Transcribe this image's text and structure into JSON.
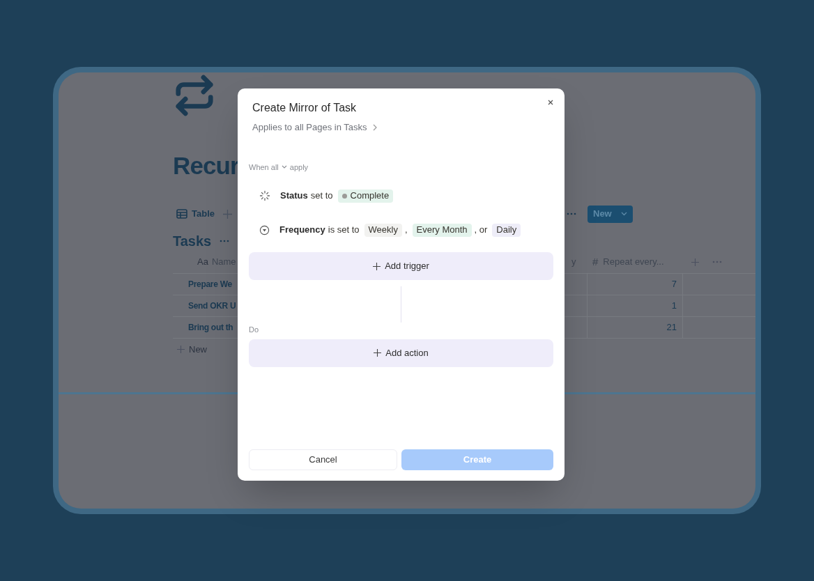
{
  "backdrop": {
    "title": "Recur",
    "view_tab": "Table",
    "database_title": "Tasks",
    "name_column_icon": "Aa",
    "name_column": "Name",
    "partial_column": "y",
    "repeat_column_icon": "#",
    "repeat_column": "Repeat every...",
    "new_button": "New",
    "rows": [
      {
        "name": "Prepare We",
        "repeat": "7"
      },
      {
        "name": "Send OKR U",
        "repeat": "1"
      },
      {
        "name": "Bring out th",
        "repeat": "21"
      }
    ],
    "new_row": "New"
  },
  "dialog": {
    "title": "Create Mirror of Task",
    "subtitle": "Applies to all Pages in Tasks",
    "when_prefix": "When all",
    "when_suffix": "apply",
    "triggers": [
      {
        "kind": "status",
        "property": "Status",
        "verb": "set to",
        "parts": [
          {
            "kind": "tag",
            "label": "Complete",
            "color": "#e3f3ec",
            "dot": true
          }
        ]
      },
      {
        "kind": "select",
        "property": "Frequency",
        "verb": "is set to",
        "parts": [
          {
            "kind": "tag",
            "label": "Weekly",
            "color": "#f2f2f0",
            "dot": false
          },
          {
            "kind": "text",
            "text": ","
          },
          {
            "kind": "tag",
            "label": "Every Month",
            "color": "#e3f3ec",
            "dot": false
          },
          {
            "kind": "text",
            "text": ", or"
          },
          {
            "kind": "tag",
            "label": "Daily",
            "color": "#eeedf8",
            "dot": false
          }
        ]
      }
    ],
    "add_trigger": "Add trigger",
    "do_label": "Do",
    "add_action": "Add action",
    "cancel": "Cancel",
    "create": "Create"
  }
}
